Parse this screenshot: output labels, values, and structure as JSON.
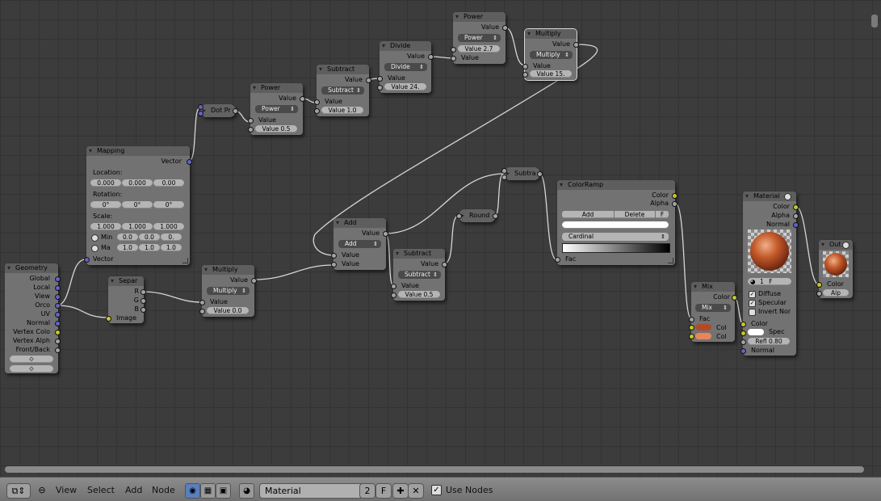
{
  "nodes": {
    "geometry": {
      "title": "Geometry",
      "outputs": [
        "Global",
        "Local",
        "View",
        "Orco",
        "UV",
        "Normal",
        "Vertex Colo",
        "Vertex Alph",
        "Front/Back"
      ]
    },
    "mapping": {
      "title": "Mapping",
      "output": "Vector",
      "location_label": "Location:",
      "location": [
        "0.000",
        "0.000",
        "0.00"
      ],
      "rotation_label": "Rotation:",
      "rotation": [
        "0°",
        "0°",
        "0°"
      ],
      "scale_label": "Scale:",
      "scale": [
        "1.000",
        "1.000",
        "1.000"
      ],
      "min_label": "Min",
      "min": [
        "0.0",
        "0.0",
        "0."
      ],
      "max_label": "Ma",
      "max": [
        "1.0",
        "1.0",
        "1.0"
      ],
      "input": "Vector"
    },
    "dot": {
      "title": "Dot Pr"
    },
    "power1": {
      "title": "Power",
      "output": "Value",
      "op": "Power",
      "in1": "Value",
      "in2": "Value 0.5"
    },
    "subtract1": {
      "title": "Subtract",
      "output": "Value",
      "op": "Subtract",
      "in1": "Value",
      "in2": "Value 1.0"
    },
    "divide": {
      "title": "Divide",
      "output": "Value",
      "op": "Divide",
      "in1": "Value",
      "in2": "Value 24."
    },
    "power2": {
      "title": "Power",
      "output": "Value",
      "op": "Power",
      "in1": "Value 2.7",
      "in2": "Value"
    },
    "multiply_top": {
      "title": "Multiply",
      "output": "Value",
      "op": "Multiply",
      "in1": "Value",
      "in2": "Value 15."
    },
    "separ": {
      "title": "Separ",
      "outputs": [
        "R",
        "G",
        "B"
      ],
      "input": "Image"
    },
    "multiply_bottom": {
      "title": "Multiply",
      "output": "Value",
      "op": "Multiply",
      "in1": "Value",
      "in2": "Value 0.0"
    },
    "add": {
      "title": "Add",
      "output": "Value",
      "op": "Add",
      "in1": "Value",
      "in2": "Value"
    },
    "subtract2": {
      "title": "Subtract",
      "output": "Value",
      "op": "Subtract",
      "in1": "Value",
      "in2": "Value 0.5"
    },
    "round": {
      "title": "Round"
    },
    "subtra": {
      "title": "Subtra"
    },
    "colorramp": {
      "title": "ColorRamp",
      "out1": "Color",
      "out2": "Alpha",
      "add": "Add",
      "delete": "Delete",
      "f": "F",
      "interp": "Cardinal",
      "input": "Fac"
    },
    "mix": {
      "title": "Mix",
      "output": "Color",
      "op": "Mix",
      "fac": "Fac",
      "col1": "Col",
      "col2": "Col",
      "col1_color": "#b24a2a",
      "col2_color": "#e8865a"
    },
    "material": {
      "title": "Material",
      "outputs": [
        "Color",
        "Alpha",
        "Normal"
      ],
      "slot": "1",
      "slot_f": "F",
      "diffuse": "Diffuse",
      "specular": "Specular",
      "invert": "Invert Nor",
      "color": "Color",
      "spec": "Spec",
      "refl": "Refl 0.80",
      "normal": "Normal"
    },
    "output": {
      "title": "Out",
      "color": "Color",
      "alpha": "Alp"
    }
  },
  "header": {
    "menus": [
      "View",
      "Select",
      "Add",
      "Node"
    ],
    "material_name": "Material",
    "users": "2",
    "fake": "F",
    "use_nodes": "Use Nodes"
  },
  "colors": {
    "socket_gray": "#a3a3a3",
    "socket_blue": "#6363c7",
    "socket_yellow": "#c7c729",
    "canvas": "#3c3c3c",
    "node": "#727272"
  }
}
